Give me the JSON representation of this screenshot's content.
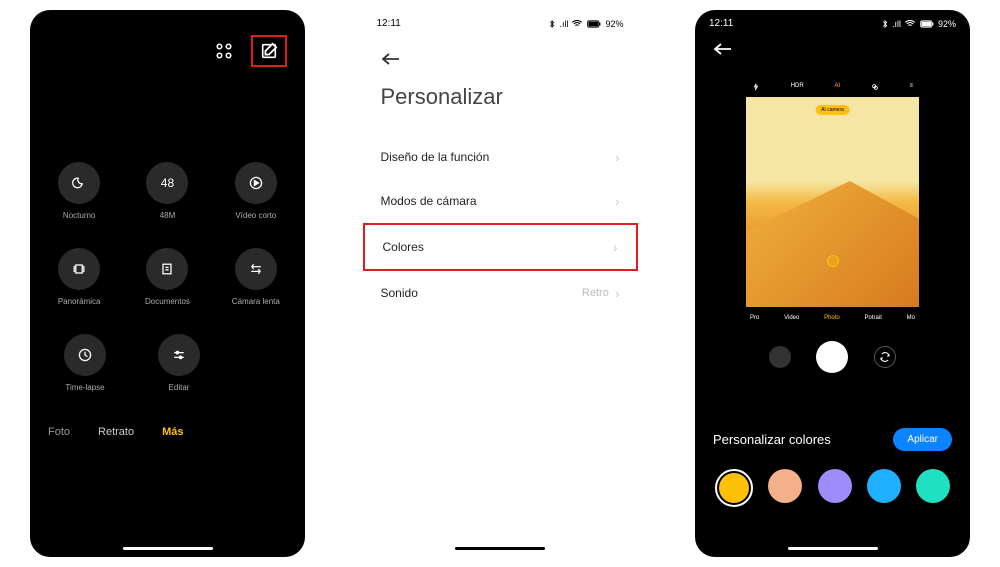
{
  "statusbar": {
    "time": "12:11",
    "battery": "92%"
  },
  "phone1": {
    "modes": [
      {
        "label": "Nocturno",
        "icon": "moon"
      },
      {
        "label": "48M",
        "icon": "48"
      },
      {
        "label": "Vídeo corto",
        "icon": "play"
      },
      {
        "label": "Panorámica",
        "icon": "pano"
      },
      {
        "label": "Documentos",
        "icon": "doc"
      },
      {
        "label": "Cámara lenta",
        "icon": "slow"
      },
      {
        "label": "Time-lapse",
        "icon": "clock"
      },
      {
        "label": "Editar",
        "icon": "sliders"
      }
    ],
    "tabs": {
      "foto": "Foto",
      "retrato": "Retrato",
      "mas": "Más"
    }
  },
  "phone2": {
    "title": "Personalizar",
    "items": {
      "diseno": "Diseño de la función",
      "modos": "Modos de cámara",
      "colores": "Colores",
      "sonido": "Sonido",
      "sonido_value": "Retro"
    }
  },
  "phone3": {
    "preview": {
      "hdr": "HDR",
      "ai": "AI",
      "ai_badge": "AI camera",
      "modes": {
        "pro": "Pro",
        "video": "Video",
        "photo": "Photo",
        "portrait": "Potrait",
        "more": "Mo"
      }
    },
    "bottom": {
      "title": "Personalizar colores",
      "apply": "Aplicar"
    },
    "colors": [
      "#ffc107",
      "#f4b088",
      "#9e8cfb",
      "#1fb0ff",
      "#1fe0c0"
    ]
  }
}
